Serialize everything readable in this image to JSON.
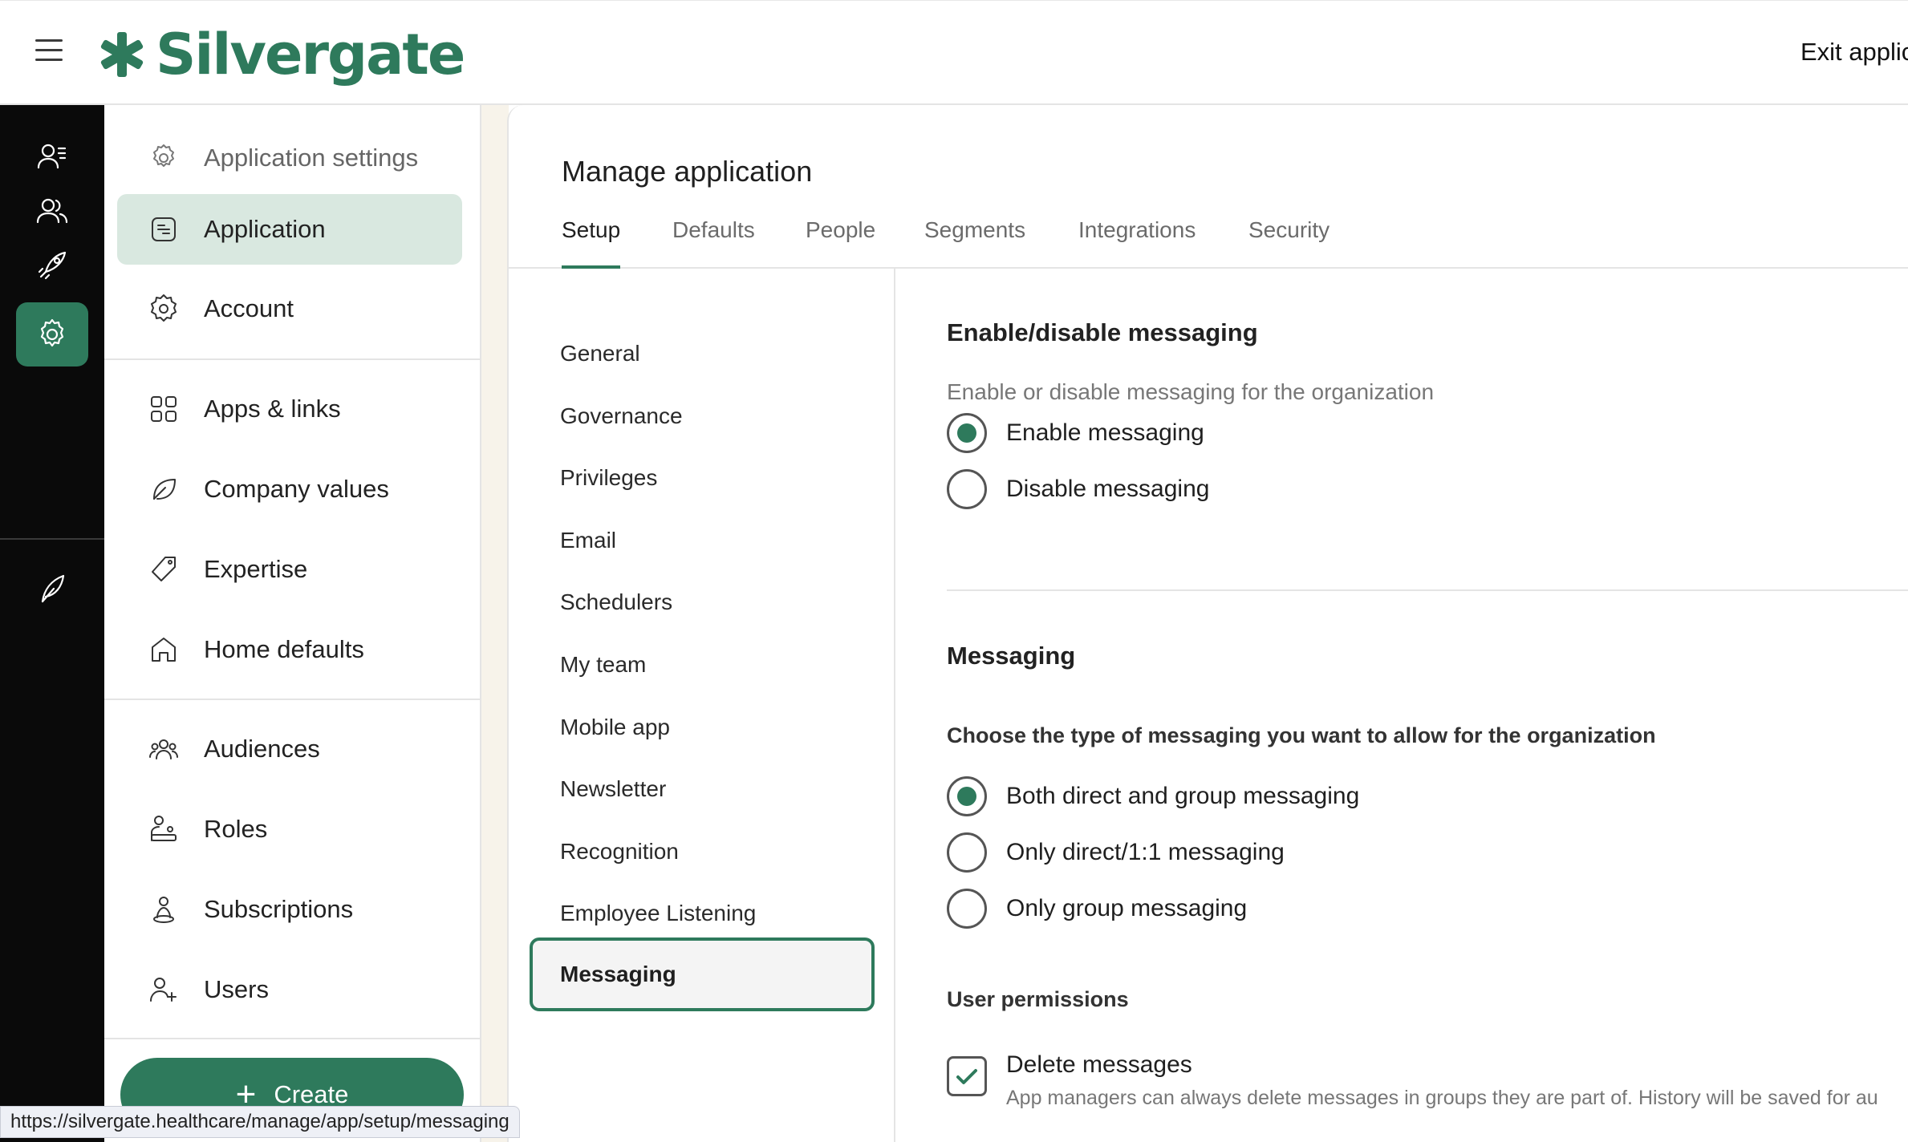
{
  "header": {
    "brand": "Silvergate",
    "exit_label": "Exit applicati",
    "brand_color": "#2e7a5c"
  },
  "rail": {
    "items": [
      {
        "icon": "user-list-icon"
      },
      {
        "icon": "users-icon"
      },
      {
        "icon": "rocket-icon"
      },
      {
        "icon": "chart-icon"
      },
      {
        "icon": "gear-icon",
        "active": true
      },
      {
        "icon": "feather-icon"
      }
    ]
  },
  "sidebar": {
    "items": [
      {
        "label": "Application settings",
        "icon": "gear-icon"
      },
      {
        "label": "Application",
        "icon": "app-icon",
        "active": true
      },
      {
        "label": "Account",
        "icon": "gear-badge-icon"
      },
      {
        "label": "Apps & links",
        "icon": "grid-icon"
      },
      {
        "label": "Company values",
        "icon": "leaf-icon"
      },
      {
        "label": "Expertise",
        "icon": "tag-icon"
      },
      {
        "label": "Home defaults",
        "icon": "home-icon"
      },
      {
        "label": "Audiences",
        "icon": "audiences-icon"
      },
      {
        "label": "Roles",
        "icon": "roles-icon"
      },
      {
        "label": "Subscriptions",
        "icon": "subscriptions-icon"
      },
      {
        "label": "Users",
        "icon": "user-add-icon"
      }
    ],
    "create_label": "Create"
  },
  "main": {
    "title": "Manage application",
    "tabs": [
      {
        "label": "Setup",
        "active": true
      },
      {
        "label": "Defaults"
      },
      {
        "label": "People"
      },
      {
        "label": "Segments"
      },
      {
        "label": "Integrations"
      },
      {
        "label": "Security"
      }
    ],
    "subnav": [
      "General",
      "Governance",
      "Privileges",
      "Email",
      "Schedulers",
      "My team",
      "Mobile app",
      "Newsletter",
      "Recognition",
      "Employee Listening"
    ],
    "subnav_active": "Messaging"
  },
  "content": {
    "enable_section": {
      "title": "Enable/disable messaging",
      "description": "Enable or disable messaging for the organization",
      "options": [
        {
          "label": "Enable messaging",
          "selected": true
        },
        {
          "label": "Disable messaging",
          "selected": false
        }
      ]
    },
    "messaging_section": {
      "title": "Messaging",
      "prompt": "Choose the type of messaging you want to allow for the organization",
      "options": [
        {
          "label": "Both direct and group messaging",
          "selected": true
        },
        {
          "label": "Only direct/1:1 messaging",
          "selected": false
        },
        {
          "label": "Only group messaging",
          "selected": false
        }
      ]
    },
    "permissions": {
      "title": "User permissions",
      "delete_messages": {
        "label": "Delete messages",
        "help": "App managers can always delete messages in groups they are part of. History will be saved for au",
        "checked": true
      }
    }
  },
  "status_url": "https://silvergate.healthcare/manage/app/setup/messaging"
}
